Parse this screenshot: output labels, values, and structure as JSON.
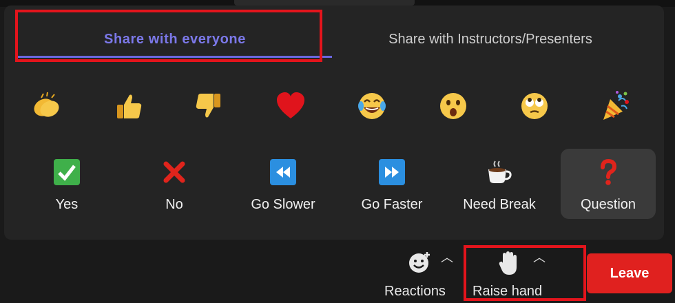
{
  "tabs": [
    {
      "label": "Share with everyone"
    },
    {
      "label": "Share with Instructors/Presenters"
    }
  ],
  "reactions": [
    {
      "icon": "clapping-hands-icon"
    },
    {
      "icon": "thumbs-up-icon"
    },
    {
      "icon": "thumbs-down-icon"
    },
    {
      "icon": "red-heart-icon"
    },
    {
      "icon": "tears-of-joy-icon"
    },
    {
      "icon": "surprised-face-icon"
    },
    {
      "icon": "eye-roll-face-icon"
    },
    {
      "icon": "party-popper-icon"
    }
  ],
  "feedback": [
    {
      "label": "Yes",
      "icon": "check-icon"
    },
    {
      "label": "No",
      "icon": "x-icon"
    },
    {
      "label": "Go Slower",
      "icon": "rewind-icon"
    },
    {
      "label": "Go Faster",
      "icon": "fast-forward-icon"
    },
    {
      "label": "Need Break",
      "icon": "coffee-icon"
    },
    {
      "label": "Question",
      "icon": "question-icon"
    }
  ],
  "toolbar": {
    "reactions_label": "Reactions",
    "raise_hand_label": "Raise hand",
    "leave_label": "Leave"
  },
  "colors": {
    "accent": "#6b67e0",
    "leave": "#e0211f",
    "highlight": "#e3141c"
  }
}
